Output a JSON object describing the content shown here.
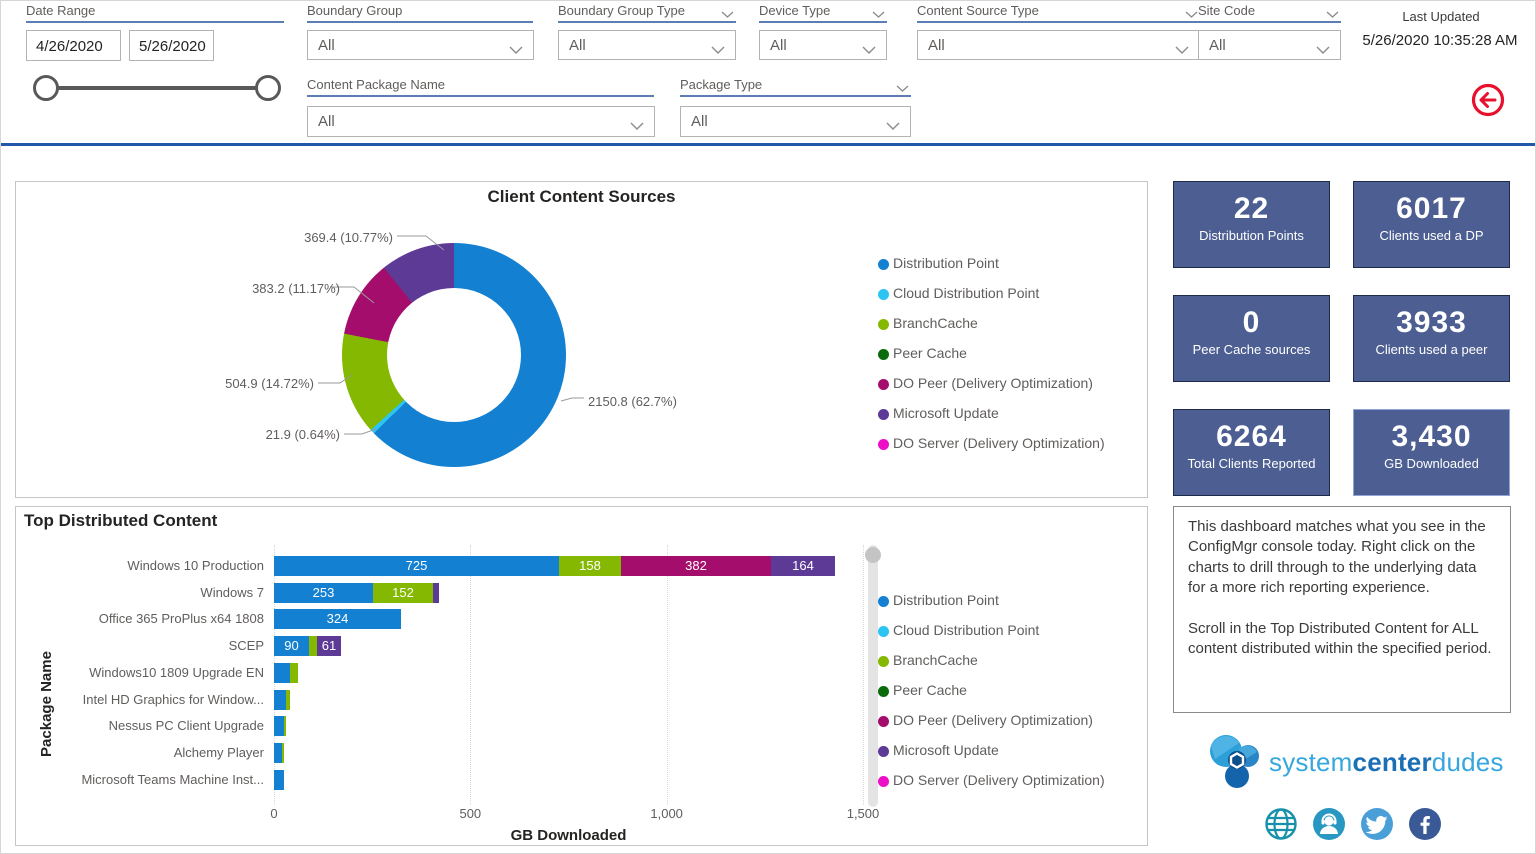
{
  "header": {
    "date_range": {
      "label": "Date Range",
      "start": "4/26/2020",
      "end": "5/26/2020"
    },
    "filters": {
      "boundary_group": {
        "label": "Boundary Group",
        "value": "All"
      },
      "boundary_group_type": {
        "label": "Boundary Group Type",
        "value": "All"
      },
      "device_type": {
        "label": "Device Type",
        "value": "All"
      },
      "content_source_type": {
        "label": "Content Source Type",
        "value": "All"
      },
      "site_code": {
        "label": "Site Code",
        "value": "All"
      },
      "content_package_name": {
        "label": "Content Package Name",
        "value": "All"
      },
      "package_type": {
        "label": "Package Type",
        "value": "All"
      }
    },
    "last_updated": {
      "label": "Last Updated",
      "value": "5/26/2020 10:35:28 AM"
    }
  },
  "legend": [
    {
      "label": "Distribution Point",
      "color": "#1380d2"
    },
    {
      "label": "Cloud Distribution Point",
      "color": "#2bc4f3"
    },
    {
      "label": "BranchCache",
      "color": "#84b801"
    },
    {
      "label": "Peer Cache",
      "color": "#0b6a0b"
    },
    {
      "label": "DO Peer (Delivery Optimization)",
      "color": "#a50d6d"
    },
    {
      "label": "Microsoft Update",
      "color": "#5d3a96"
    },
    {
      "label": "DO Server (Delivery Optimization)",
      "color": "#ed0fc6"
    }
  ],
  "kpis": [
    {
      "value": "22",
      "label": "Distribution Points"
    },
    {
      "value": "6017",
      "label": "Clients used a DP"
    },
    {
      "value": "0",
      "label": "Peer Cache sources"
    },
    {
      "value": "3933",
      "label": "Clients used a peer"
    },
    {
      "value": "6264",
      "label": "Total Clients Reported"
    },
    {
      "value": "3,430",
      "label": "GB Downloaded",
      "highlight": true
    }
  ],
  "note": {
    "para1": "This dashboard matches what you see in the ConfigMgr console today. Right click on the charts to drill through to the underlying data for a more rich reporting experience.",
    "para2": "Scroll in the Top Distributed Content for ALL content distributed within the specified period."
  },
  "branding": {
    "name_part1": "system",
    "name_part2": "center",
    "name_part3": "dudes",
    "social_icons": [
      "website-globe",
      "support-person",
      "twitter",
      "facebook"
    ]
  },
  "colors": {
    "divider_blue": "#2258a8",
    "kpi_background": "#4c5e92",
    "back_arrow_red": "#e8112d"
  },
  "chart_data": [
    {
      "type": "pie",
      "title": "Client Content Sources",
      "donut": true,
      "start_angle": "top",
      "direction": "clockwise",
      "legend_position": "right",
      "slices": [
        {
          "label": "Distribution Point",
          "value": 2150.8,
          "pct": 62.7,
          "data_label": "2150.8 (62.7%)"
        },
        {
          "label": "Cloud Distribution Point",
          "value": 21.9,
          "pct": 0.64,
          "data_label": "21.9 (0.64%)"
        },
        {
          "label": "BranchCache",
          "value": 504.9,
          "pct": 14.72,
          "data_label": "504.9 (14.72%)"
        },
        {
          "label": "DO Peer (Delivery Optimization)",
          "value": 383.2,
          "pct": 11.17,
          "data_label": "383.2 (11.17%)"
        },
        {
          "label": "Microsoft Update",
          "value": 369.4,
          "pct": 10.77,
          "data_label": "369.4 (10.77%)"
        }
      ]
    },
    {
      "type": "bar",
      "title": "Top Distributed Content",
      "orientation": "horizontal",
      "stacked": true,
      "xlabel": "GB Downloaded",
      "ylabel": "Package Name",
      "xlim": [
        0,
        1500
      ],
      "x_ticks": [
        0,
        500,
        1000,
        1500
      ],
      "x_tick_labels": [
        "0",
        "500",
        "1,000",
        "1,500"
      ],
      "grid": "dotted-vertical",
      "legend_position": "right",
      "data_label_min_value": 50,
      "categories": [
        "Windows 10 Production",
        "Windows 7",
        "Office 365 ProPlus x64 1808",
        "SCEP",
        "Windows10 1809 Upgrade EN",
        "Intel HD Graphics for Window...",
        "Nessus PC Client Upgrade",
        "Alchemy Player",
        "Microsoft Teams Machine Inst..."
      ],
      "series": [
        {
          "name": "Distribution Point",
          "values": [
            725,
            253,
            324,
            90,
            40,
            30,
            25,
            20,
            25
          ]
        },
        {
          "name": "BranchCache",
          "values": [
            158,
            152,
            0,
            20,
            20,
            10,
            5,
            5,
            0
          ]
        },
        {
          "name": "DO Peer (Delivery Optimization)",
          "values": [
            382,
            0,
            0,
            0,
            0,
            0,
            0,
            0,
            0
          ]
        },
        {
          "name": "Microsoft Update",
          "values": [
            164,
            15,
            0,
            61,
            0,
            0,
            0,
            0,
            0
          ]
        }
      ]
    }
  ]
}
